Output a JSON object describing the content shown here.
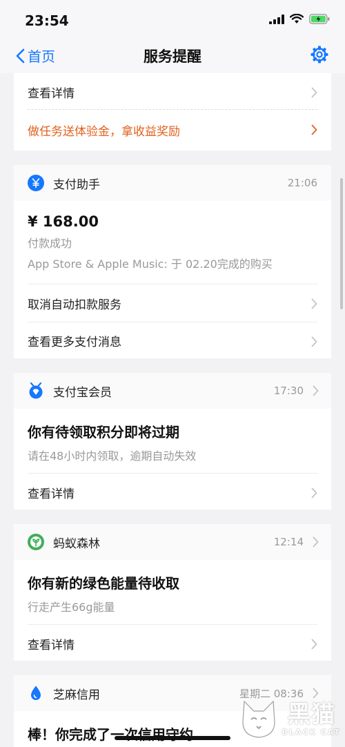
{
  "status_bar": {
    "time": "23:54"
  },
  "nav": {
    "back_label": "首页",
    "title": "服务提醒"
  },
  "card0": {
    "detail_label": "查看详情",
    "promo_label": "做任务送体验金，拿收益奖励",
    "promo_color": "#e2611e"
  },
  "card1": {
    "app_name": "支付助手",
    "time": "21:06",
    "amount": "¥ 168.00",
    "status": "付款成功",
    "description": "App Store & Apple Music: 于 02.20完成的购买",
    "actions": [
      "取消自动扣款服务",
      "查看更多支付消息"
    ]
  },
  "card2": {
    "app_name": "支付宝会员",
    "time": "17:30",
    "headline": "你有待领取积分即将过期",
    "subtext": "请在48小时内领取，逾期自动失效",
    "detail_label": "查看详情"
  },
  "card3": {
    "app_name": "蚂蚁森林",
    "time": "12:14",
    "headline": "你有新的绿色能量待收取",
    "subtext": "行走产生66g能量",
    "detail_label": "查看详情"
  },
  "card4": {
    "app_name": "芝麻信用",
    "time": "星期二 08:36",
    "headline": "棒！你完成了一次信用守约"
  },
  "watermark": {
    "cn": "黑猫",
    "en": "BLACK CAT"
  },
  "colors": {
    "accent": "#1677ff",
    "background": "#f2f2f5",
    "battery": "#4cd964",
    "forest": "#3fae5a"
  }
}
